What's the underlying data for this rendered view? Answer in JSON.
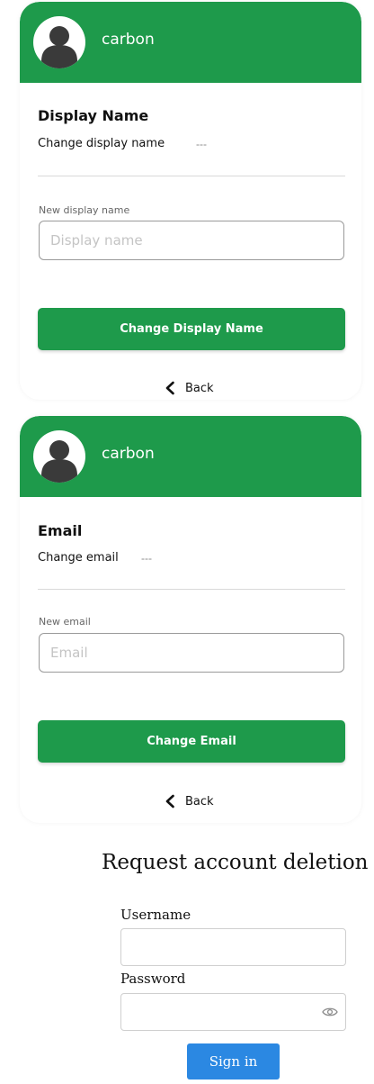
{
  "colors": {
    "brand_green": "#1e9a4b",
    "signin_blue": "#2b88e2"
  },
  "cards": [
    {
      "app_name": "carbon",
      "section_title": "Display Name",
      "row_label": "Change display name",
      "row_value": "---",
      "field_label": "New display name",
      "placeholder": "Display name",
      "button_label": "Change Display Name",
      "back_label": "Back"
    },
    {
      "app_name": "carbon",
      "section_title": "Email",
      "row_label": "Change email",
      "row_value": "---",
      "field_label": "New email",
      "placeholder": "Email",
      "button_label": "Change Email",
      "back_label": "Back"
    }
  ],
  "deletion": {
    "title": "Request account deletion",
    "username_label": "Username",
    "password_label": "Password",
    "password_toggle_icon": "eye-icon",
    "signin_label": "Sign in"
  },
  "icons": {
    "avatar": "user-silhouette-icon",
    "back": "chevron-left-icon"
  }
}
